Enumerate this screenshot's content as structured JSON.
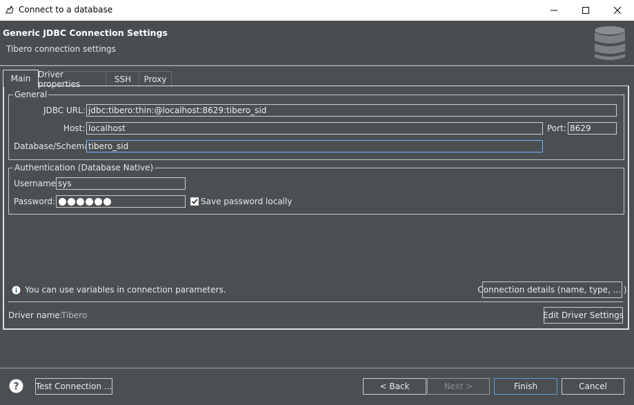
{
  "window": {
    "title": "Connect to a database",
    "minimize": "—",
    "maximize": "☐",
    "close": "✕"
  },
  "header": {
    "title": "Generic JDBC Connection Settings",
    "subtitle": "Tibero connection settings"
  },
  "tabs": [
    {
      "label": "Main",
      "active": true
    },
    {
      "label": "Driver properties",
      "active": false
    },
    {
      "label": "SSH",
      "active": false
    },
    {
      "label": "Proxy",
      "active": false
    }
  ],
  "general": {
    "legend": "General",
    "jdbc_url_label": "JDBC URL:",
    "jdbc_url_value": "jdbc:tibero:thin:@localhost:8629:tibero_sid",
    "host_label": "Host:",
    "host_value": "localhost",
    "port_label": "Port:",
    "port_value": "8629",
    "database_label": "Database/Schema:",
    "database_value": "tibero_sid"
  },
  "auth": {
    "legend": "Authentication (Database Native)",
    "username_label": "Username:",
    "username_value": "sys",
    "password_label": "Password:",
    "password_mask_count": 6,
    "save_password_label": "Save password locally",
    "save_password_checked": true
  },
  "info": {
    "text": "You can use variables in connection parameters."
  },
  "connection_details_button": "Connection details (name, type, ... )",
  "driver": {
    "label": "Driver name:",
    "value": "Tibero",
    "edit_button": "Edit Driver Settings"
  },
  "footer": {
    "test_connection": "Test Connection ...",
    "back": "< Back",
    "next": "Next >",
    "finish": "Finish",
    "cancel": "Cancel"
  }
}
